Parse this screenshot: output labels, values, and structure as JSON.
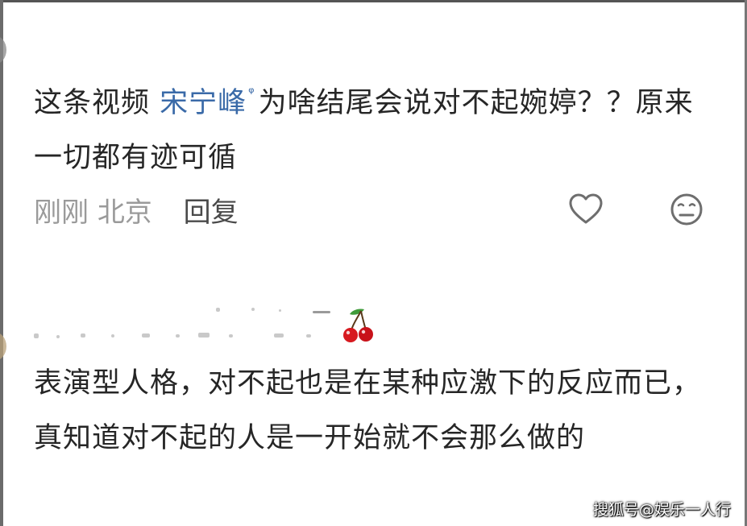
{
  "comment1": {
    "text_before": "这条视频 ",
    "mention": "宋宁峰",
    "text_after": "为啥结尾会说对不起婉婷？？原来一切都有迹可循",
    "time": "刚刚",
    "location": "北京",
    "reply_label": "回复"
  },
  "comment2": {
    "text": "表演型人格，对不起也是在某种应激下的反应而已，真知道对不起的人是一开始就不会那么做的"
  },
  "watermark": "搜狐号@娱乐一人行",
  "icons": {
    "like": "heart-outline-icon",
    "dislike": "neutral-face-icon",
    "badge": "cherry-icon",
    "mention_search": "search-icon"
  },
  "colors": {
    "mention": "#3a6aa8",
    "meta": "#9a9a9a",
    "text": "#262626"
  }
}
